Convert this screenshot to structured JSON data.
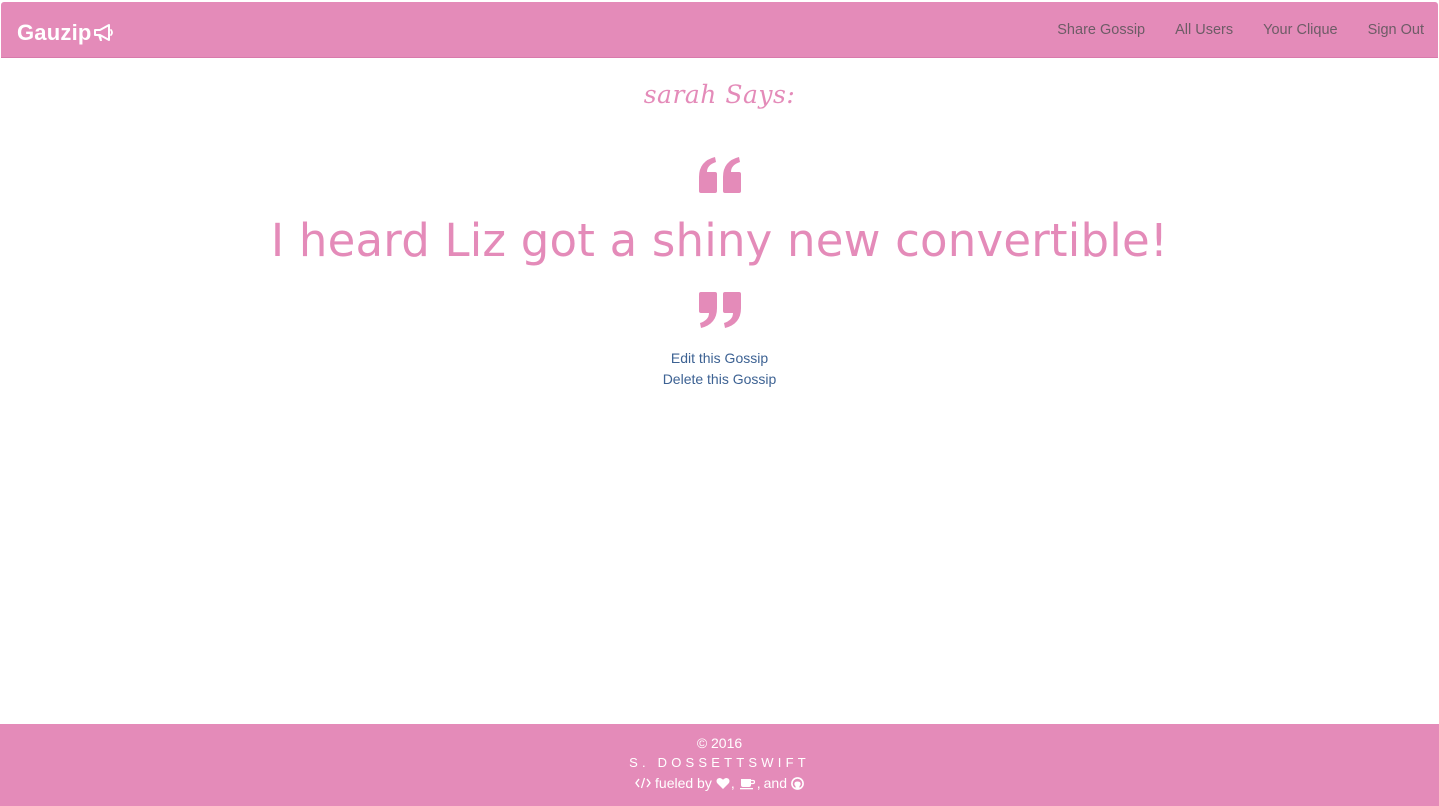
{
  "app": {
    "brand": "Gauzip",
    "brand_icon": "megaphone-icon",
    "accent_color": "#e48bb9",
    "link_color": "#3d6293"
  },
  "navbar": {
    "links": [
      {
        "label": "Share Gossip"
      },
      {
        "label": "All Users"
      },
      {
        "label": "Your Clique"
      },
      {
        "label": "Sign Out"
      }
    ]
  },
  "gossip": {
    "author_heading": "sarah Says:",
    "text": "I heard Liz got a shiny new convertible!",
    "open_quote_icon": "quote-left-icon",
    "close_quote_icon": "quote-right-icon",
    "edit_label": "Edit this Gossip",
    "delete_label": "Delete this Gossip"
  },
  "footer": {
    "copyright": "© 2016",
    "author": "S. DOSSETTSWIFT",
    "code_icon": "code-icon",
    "fueled_by": "fueled by",
    "heart_icon": "heart-icon",
    "coffee_icon": "coffee-icon",
    "and": "and",
    "github_icon": "github-icon",
    "comma": ","
  }
}
